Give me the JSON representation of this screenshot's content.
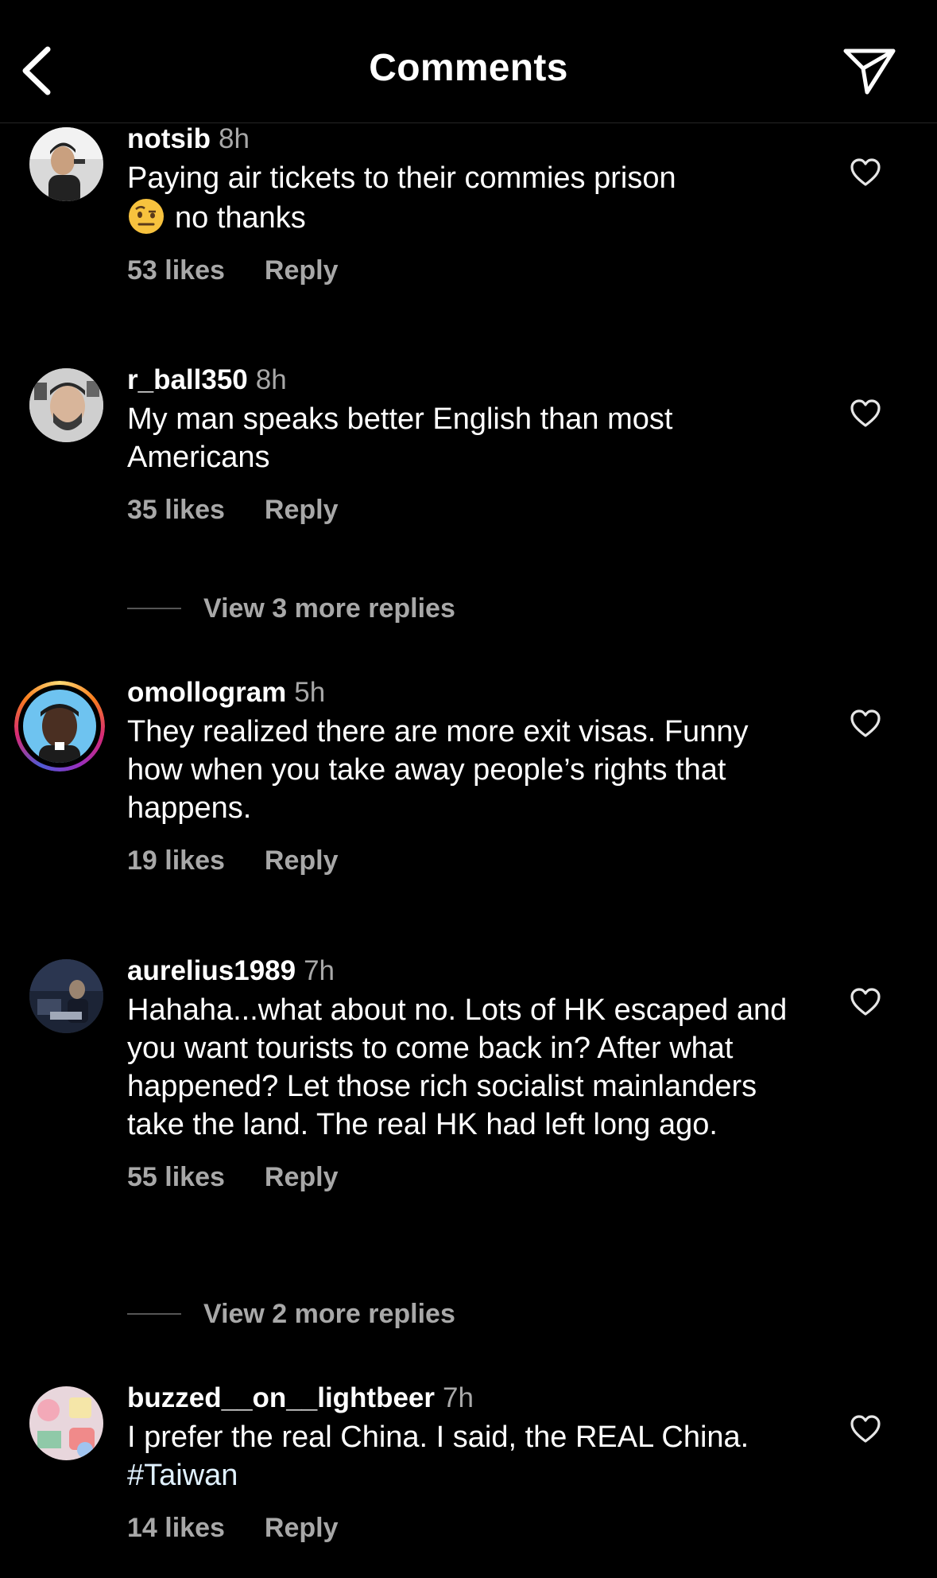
{
  "header": {
    "title": "Comments",
    "back_icon": "chevron-left-icon",
    "share_icon": "paper-plane-icon"
  },
  "comments": [
    {
      "username": "notsib",
      "time": "8h",
      "text": "Paying air tickets to their commies prison",
      "text_line2": "no thanks",
      "emoji": "face-with-raised-eyebrow",
      "likes": "53 likes",
      "reply": "Reply"
    },
    {
      "username": "r_ball350",
      "time": "8h",
      "text": "My man speaks better English than most Americans",
      "likes": "35 likes",
      "reply": "Reply"
    },
    {
      "username": "omollogram",
      "time": "5h",
      "text": "They realized there are more exit visas. Funny how when you take away people’s rights that happens.",
      "likes": "19 likes",
      "reply": "Reply"
    },
    {
      "username": "aurelius1989",
      "time": "7h",
      "text": "Hahaha...what about no. Lots of HK escaped and you want tourists to come back in? After what happened? Let those rich socialist mainlanders take the land. The real HK had left long ago.",
      "likes": "55 likes",
      "reply": "Reply"
    },
    {
      "username": "buzzed__on__lightbeer",
      "time": "7h",
      "text": "I prefer the real China. I said, the REAL China.",
      "hashtag": "#Taiwan",
      "likes": "14 likes",
      "reply": "Reply"
    }
  ],
  "view_more": [
    {
      "label": "View 3 more replies"
    },
    {
      "label": "View 2 more replies"
    }
  ],
  "colors": {
    "background": "#000000",
    "secondary_text": "#a8a8a8",
    "divider": "#262626"
  }
}
